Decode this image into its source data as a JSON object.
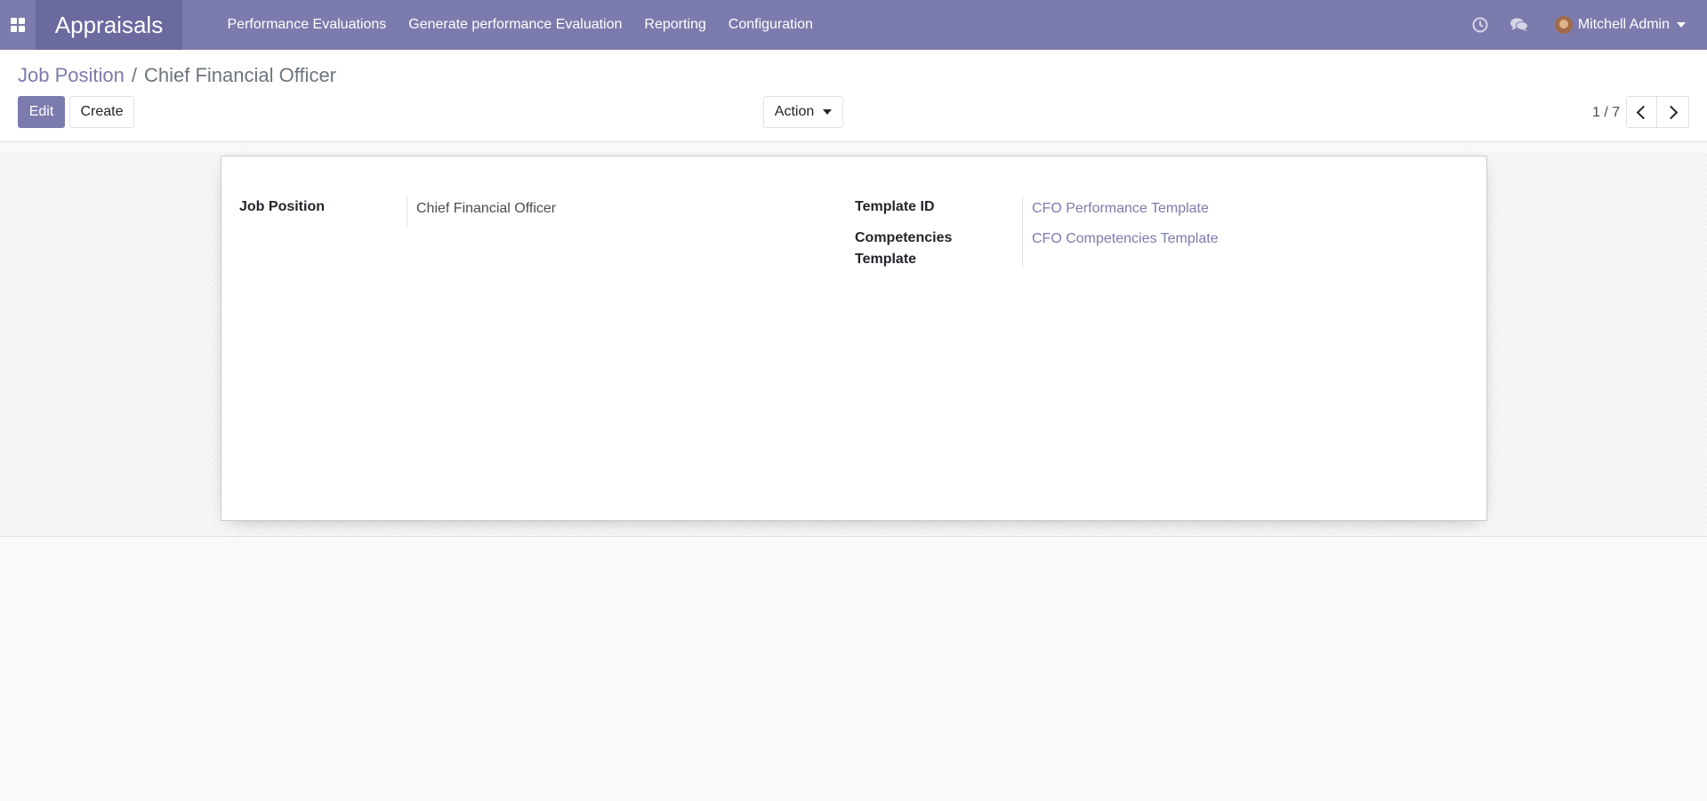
{
  "navbar": {
    "app_name": "Appraisals",
    "menu": [
      {
        "label": "Performance Evaluations"
      },
      {
        "label": "Generate performance Evaluation"
      },
      {
        "label": "Reporting"
      },
      {
        "label": "Configuration"
      }
    ],
    "user_name": "Mitchell Admin",
    "colors": {
      "brand": "#7c7bad",
      "brand_dark": "#6b6a9f"
    }
  },
  "breadcrumb": {
    "parent": "Job Position",
    "separator": "/",
    "current": "Chief Financial Officer"
  },
  "actions": {
    "edit": "Edit",
    "create": "Create",
    "action_menu": "Action"
  },
  "pager": {
    "value": "1 / 7"
  },
  "form": {
    "job_position_label": "Job Position",
    "job_position_value": "Chief Financial Officer",
    "template_id_label": "Template ID",
    "template_id_value": "CFO Performance Template",
    "competencies_label": "Competencies Template",
    "competencies_value": "CFO Competencies Template"
  }
}
